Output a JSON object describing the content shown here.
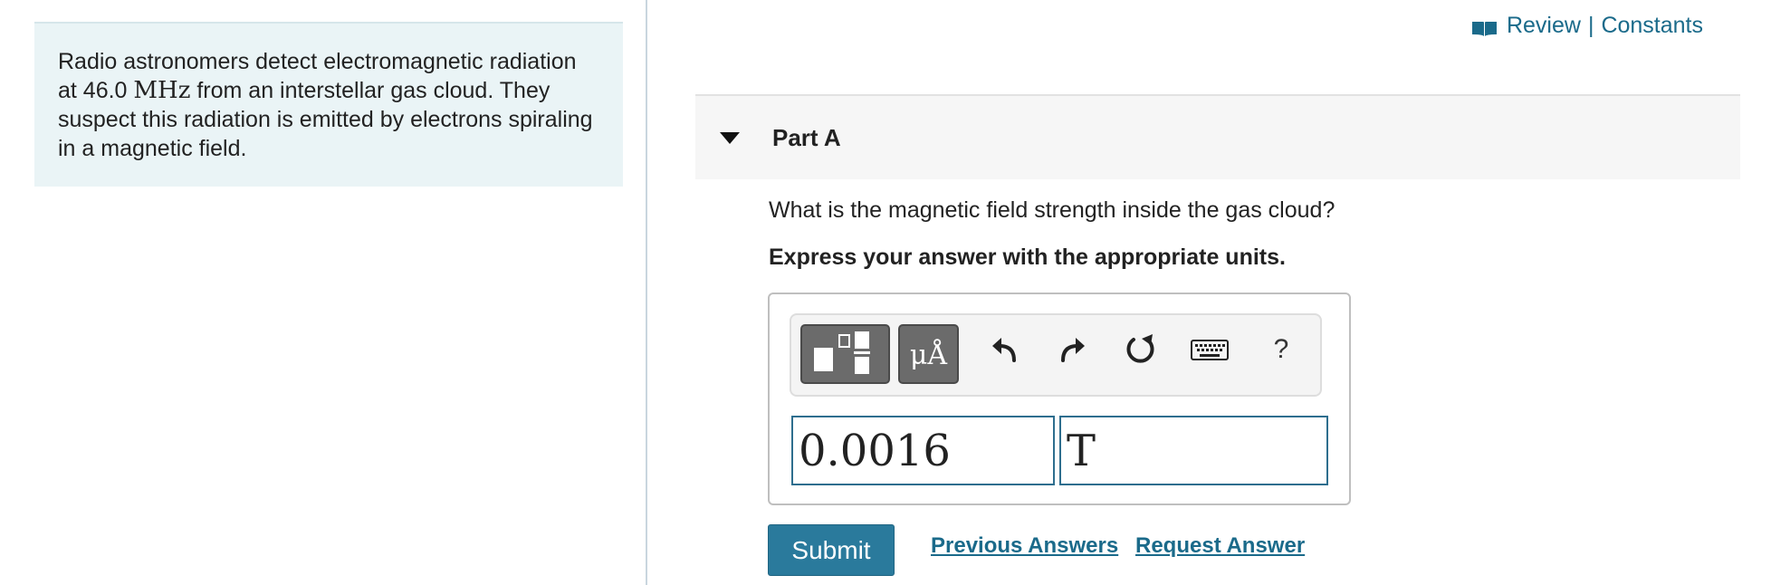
{
  "problem": {
    "text_before_unit": "Radio astronomers detect electromagnetic radiation at 46.0 ",
    "unit": "MHz",
    "text_after_unit": " from an interstellar gas cloud. They suspect this radiation is emitted by electrons spiraling in a magnetic field."
  },
  "header_links": {
    "review": "Review",
    "separator": "|",
    "constants": "Constants",
    "icon": "book-icon"
  },
  "part": {
    "title": "Part A",
    "question": "What is the magnetic field strength inside the gas cloud?",
    "instruction": "Express your answer with the appropriate units."
  },
  "toolbar": {
    "templates_icon": "templates-icon",
    "units_label": "μÅ",
    "undo_icon": "undo-icon",
    "redo_icon": "redo-icon",
    "reset_icon": "reset-icon",
    "keyboard_icon": "keyboard-icon",
    "help_label": "?"
  },
  "answer": {
    "value": "0.0016",
    "unit": "T"
  },
  "actions": {
    "submit": "Submit",
    "previous_answers": "Previous Answers",
    "request_answer": "Request Answer"
  },
  "colors": {
    "link": "#1a6a8a",
    "submit_bg": "#2a7a9c",
    "problem_bg": "#eaf4f6",
    "input_border": "#2e6e8e"
  }
}
